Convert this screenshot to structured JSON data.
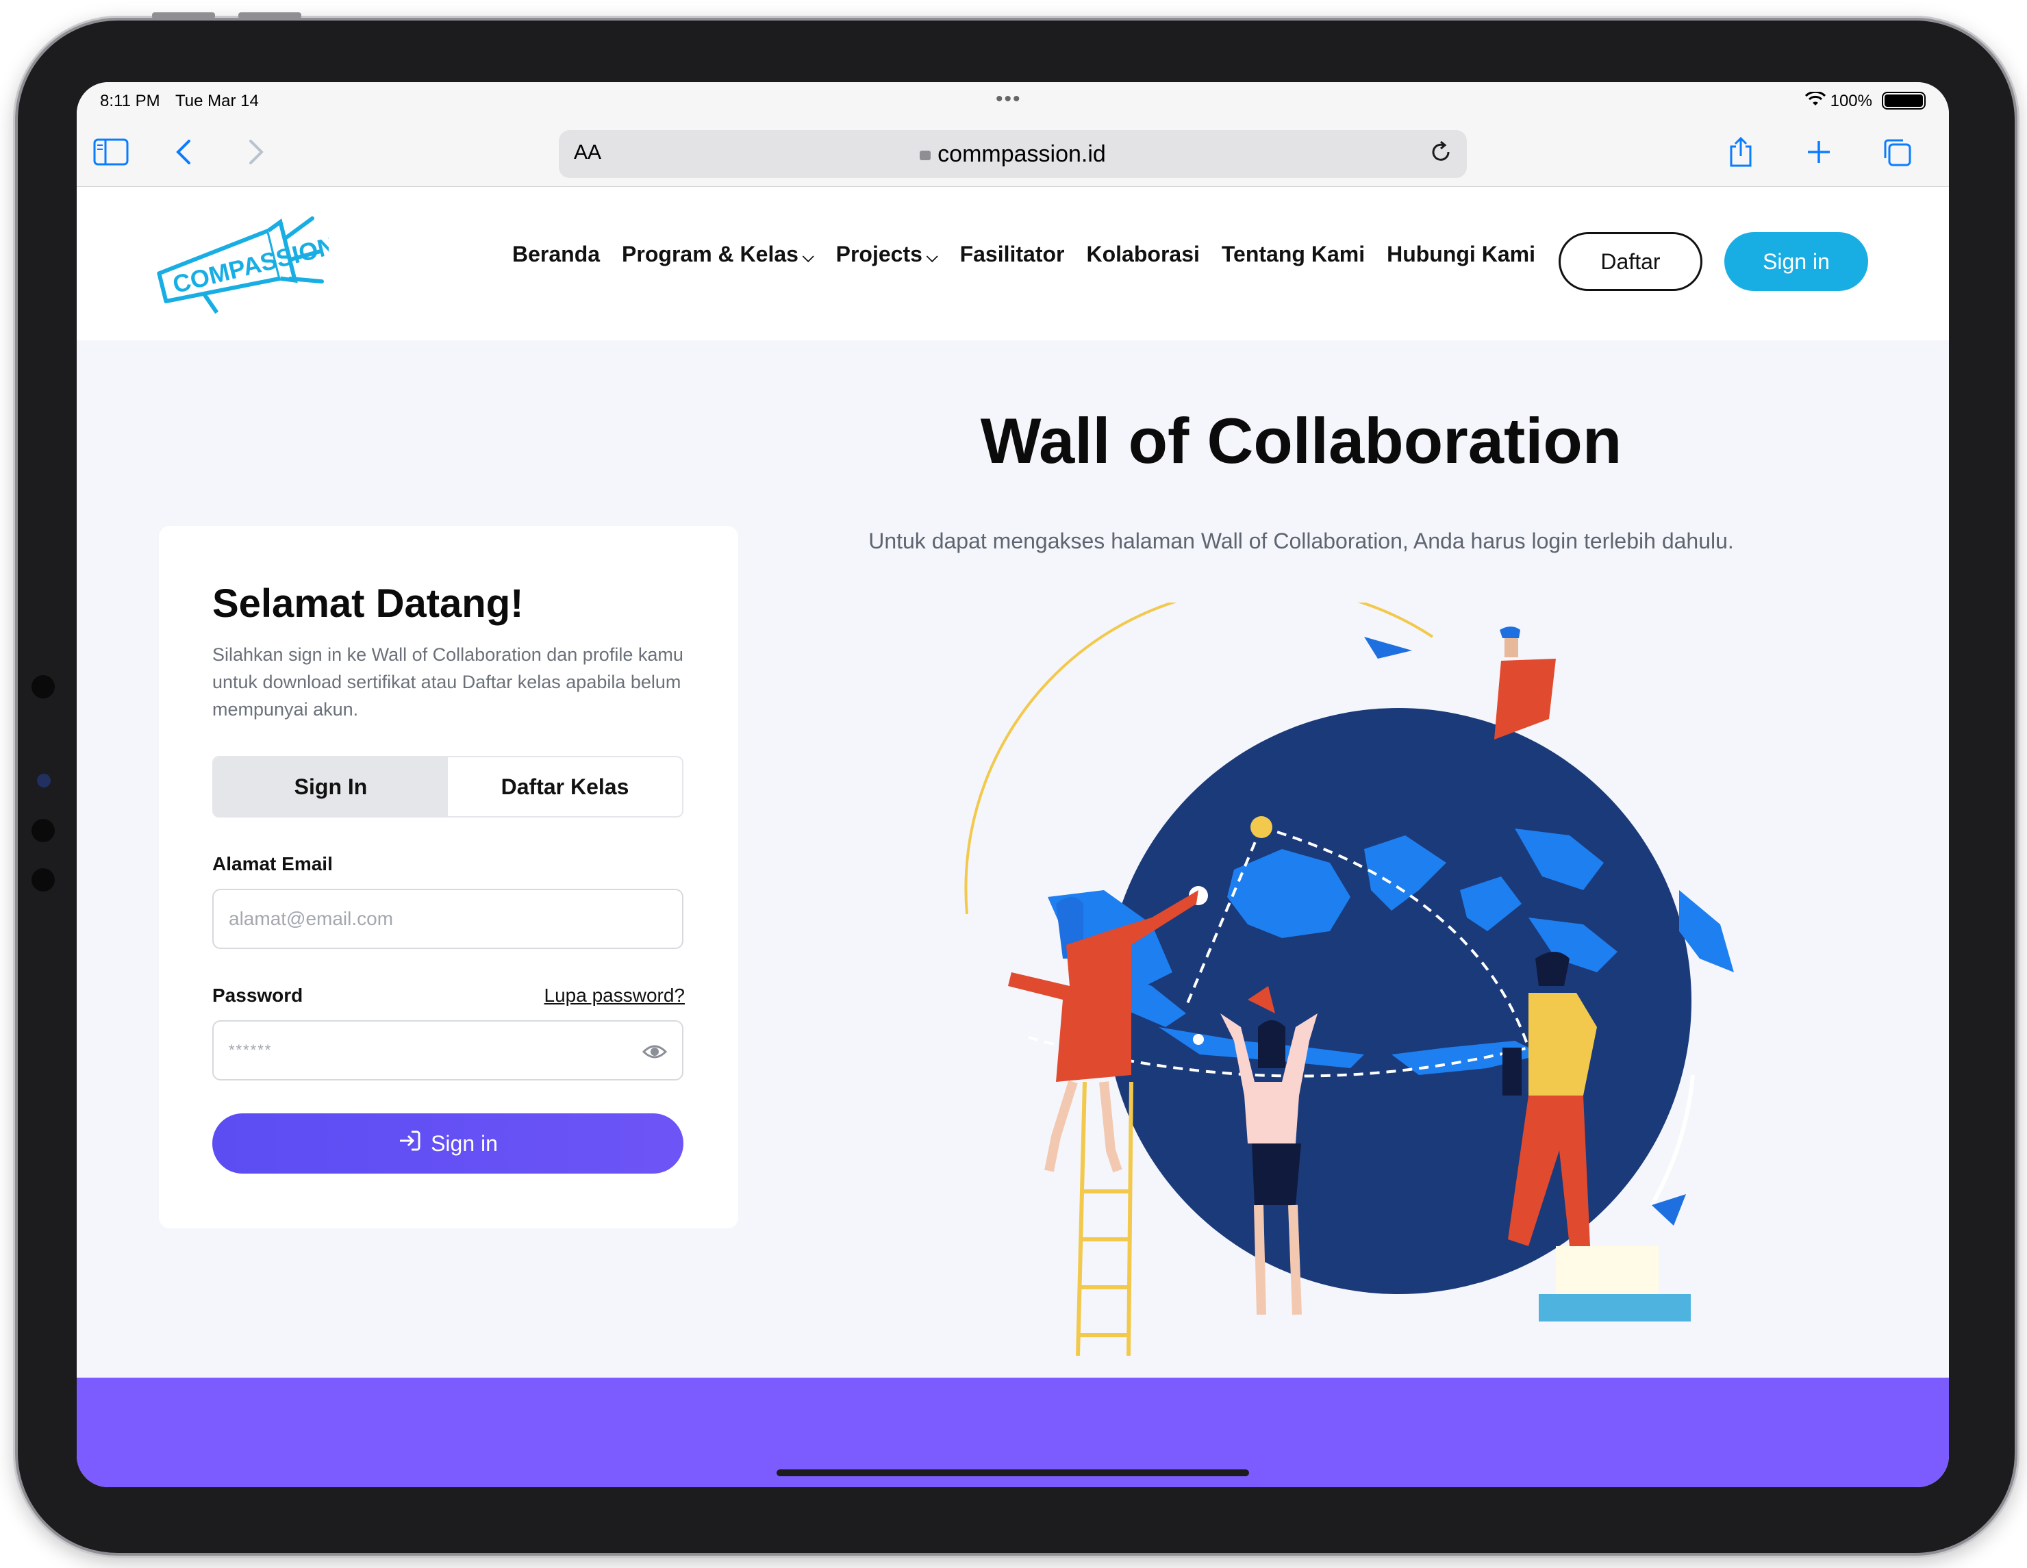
{
  "status_bar": {
    "time": "8:11 PM",
    "date": "Tue Mar 14",
    "battery": "100%"
  },
  "browser": {
    "aa_label": "AA",
    "url": "commpassion.id",
    "icons": [
      "sidebar-icon",
      "back-icon",
      "forward-icon",
      "lock-icon",
      "reload-icon",
      "share-icon",
      "new-tab-icon",
      "tabs-icon"
    ]
  },
  "header": {
    "logo_text": "COMPASSION",
    "nav": [
      {
        "label": "Beranda",
        "dropdown": false
      },
      {
        "label": "Program & Kelas",
        "dropdown": true
      },
      {
        "label": "Projects",
        "dropdown": true
      },
      {
        "label": "Fasilitator",
        "dropdown": false
      },
      {
        "label": "Kolaborasi",
        "dropdown": false
      },
      {
        "label": "Tentang Kami",
        "dropdown": false
      },
      {
        "label": "Hubungi Kami",
        "dropdown": false
      }
    ],
    "daftar_label": "Daftar",
    "signin_label": "Sign in"
  },
  "hero": {
    "title": "Wall of Collaboration",
    "subtitle": "Untuk dapat mengakses halaman Wall of Collaboration, Anda harus login terlebih dahulu."
  },
  "login": {
    "title": "Selamat Datang!",
    "description": "Silahkan sign in ke Wall of Collaboration dan profile kamu untuk download sertifikat atau Daftar kelas apabila belum mempunyai akun.",
    "tabs": [
      {
        "label": "Sign In",
        "active": true
      },
      {
        "label": "Daftar Kelas",
        "active": false
      }
    ],
    "email_label": "Alamat Email",
    "email_placeholder": "alamat@email.com",
    "password_label": "Password",
    "forgot_label": "Lupa password?",
    "password_placeholder": "******",
    "submit_label": "Sign in"
  },
  "colors": {
    "accent_blue": "#18aee4",
    "submit_purple": "#5b4df2",
    "footer_purple": "#7c5bff",
    "globe_navy": "#1b3a7a",
    "map_blue": "#1e7ff0"
  }
}
